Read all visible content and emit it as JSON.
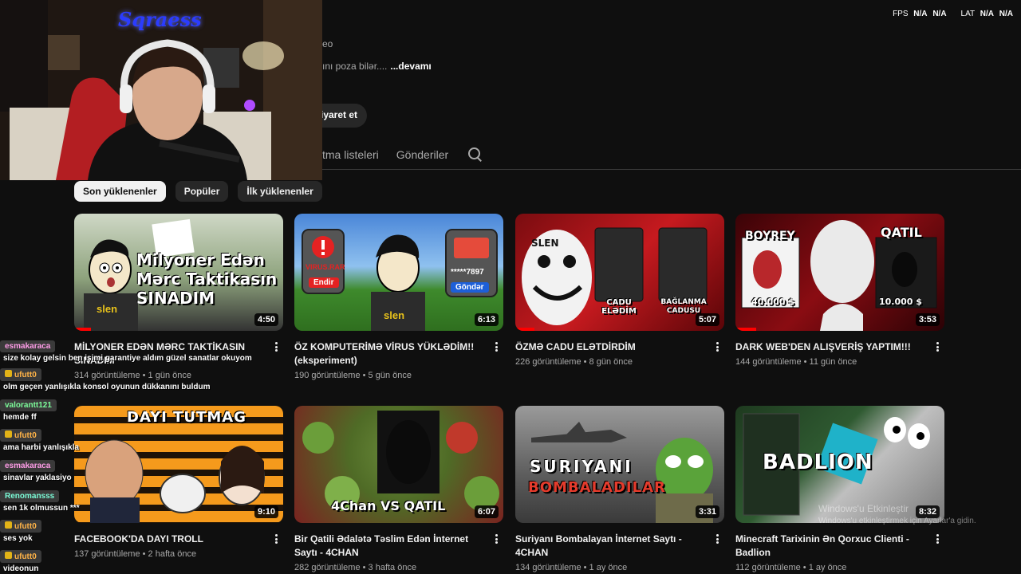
{
  "stats": {
    "fps_label": "FPS",
    "fps_value1": "N/A",
    "fps_value2": "N/A",
    "lat_label": "LAT",
    "lat_value1": "N/A",
    "lat_value2": "N/A"
  },
  "channel": {
    "subtitle_fragment": "eo",
    "description": "ını poza bilər....",
    "more_label": "...devamı",
    "visit_label": "iyaret et"
  },
  "tabs": [
    {
      "label": "tma listeleri"
    },
    {
      "label": "Gönderiler"
    }
  ],
  "chips": [
    {
      "label": "Son yüklenenler",
      "active": true
    },
    {
      "label": "Popüler",
      "active": false
    },
    {
      "label": "İlk yüklenenler",
      "active": false
    }
  ],
  "videos": [
    {
      "title": "MİLYONER EDƏN MƏRC TAKTİKASIN SINADIM",
      "views": "314 görüntüleme",
      "age": "1 gün önce",
      "duration": "4:50",
      "thumb_text": "Milyoner Edən Mərc Taktikasın SINADIM",
      "thumb_brand": "slen"
    },
    {
      "title": "ÖZ KOMPUTERİMƏ VİRUS YÜKLƏDİM!! (eksperiment)",
      "views": "190 görüntüleme",
      "age": "5 gün önce",
      "duration": "6:13",
      "thumb_text": "VIRUS.RAR",
      "thumb_btn1": "Endir",
      "thumb_card": "*****7897",
      "thumb_btn2": "Göndər",
      "thumb_brand": "slen"
    },
    {
      "title": "ÖZMƏ CADU ELƏTDİRDİM",
      "views": "226 görüntüleme",
      "age": "8 gün önce",
      "duration": "5:07",
      "thumb_text": "SLEN",
      "thumb_label1": "CADU ELƏDİM",
      "thumb_label2": "BAĞLANMA CADUSU"
    },
    {
      "title": "DARK WEB'DEN ALIŞVERİŞ YAPTIM!!!",
      "views": "144 görüntüleme",
      "age": "11 gün önce",
      "duration": "3:53",
      "thumb_text1": "BOYREY",
      "thumb_text2": "QATIL",
      "thumb_price1": "40.000 $",
      "thumb_price2": "10.000 $"
    },
    {
      "title": "FACEBOOK'DA DAYI TROLL",
      "views": "137 görüntüleme",
      "age": "2 hafta önce",
      "duration": "9:10",
      "thumb_text": "DAYI TUTMAG"
    },
    {
      "title": "Bir Qatili Ədalətə Təslim Edən İnternet Saytı - 4CHAN",
      "views": "282 görüntüleme",
      "age": "3 hafta önce",
      "duration": "6:07",
      "thumb_text": "4Chan VS QATIL"
    },
    {
      "title": "Suriyanı Bombalayan İnternet Saytı - 4CHAN",
      "views": "134 görüntüleme",
      "age": "1 ay önce",
      "duration": "3:31",
      "thumb_text1": "SURIYANI",
      "thumb_text2": "BOMBALADILAR"
    },
    {
      "title": "Minecraft Tarixinin Ən Qorxuc Clienti - Badlion",
      "views": "112 görüntüleme",
      "age": "1 ay önce",
      "duration": "8:32",
      "thumb_text": "BADLION"
    }
  ],
  "stream": {
    "logo": "Sqraess"
  },
  "chat": [
    {
      "user": "esmakaraca",
      "text": "size kolay gelsin ben işimi garantiye aldım güzel sanatlar okuyom",
      "badge": false
    },
    {
      "user": "ufutt0",
      "text": "olm geçen yanlışıkla konsol oyunun dükkanını buldum",
      "badge": true
    },
    {
      "user": "valorantt121",
      "text": "hemde ff",
      "badge": false
    },
    {
      "user": "ufutt0",
      "text": "ama harbi yanlışıkla",
      "badge": true
    },
    {
      "user": "esmakaraca",
      "text": "sinavlar yaklasiyo",
      "badge": false
    },
    {
      "user": "Renomansss",
      "text": "sen 1k olmussun ***",
      "badge": false
    },
    {
      "user": "ufutt0",
      "text": "ses yok",
      "badge": true
    },
    {
      "user": "ufutt0",
      "text": "videonun",
      "badge": true
    }
  ],
  "watermark": {
    "line1": "Windows'u Etkinleştir",
    "line2": "Windows'u etkinleştirmek için Ayarlar'a gidin."
  }
}
